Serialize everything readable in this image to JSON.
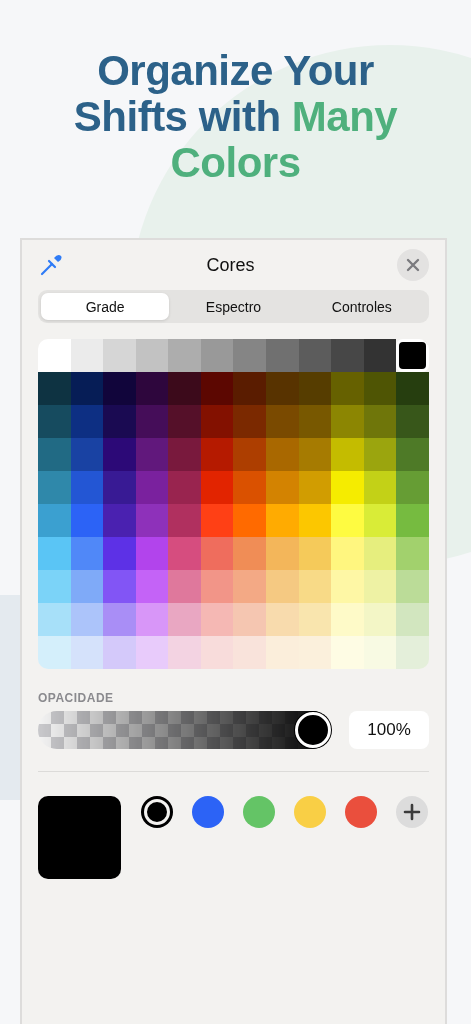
{
  "headline": {
    "parts": [
      {
        "text": "Organize Your Shifts with ",
        "accent": false
      },
      {
        "text": "Many Colors",
        "accent": true
      }
    ]
  },
  "sheet": {
    "title": "Cores"
  },
  "tabs": [
    {
      "label": "Grade",
      "selected": true
    },
    {
      "label": "Espectro",
      "selected": false
    },
    {
      "label": "Controles",
      "selected": false
    }
  ],
  "grid": [
    {
      "swatches": [
        {
          "color": "#ffffff",
          "selected": false
        },
        {
          "color": "#ebebeb",
          "selected": false
        },
        {
          "color": "#d6d6d6",
          "selected": false
        },
        {
          "color": "#c2c2c2",
          "selected": false
        },
        {
          "color": "#adadad",
          "selected": false
        },
        {
          "color": "#999999",
          "selected": false
        },
        {
          "color": "#858585",
          "selected": false
        },
        {
          "color": "#707070",
          "selected": false
        },
        {
          "color": "#5c5c5c",
          "selected": false
        },
        {
          "color": "#474747",
          "selected": false
        },
        {
          "color": "#333333",
          "selected": false
        },
        {
          "color": "#000000",
          "selected": true
        }
      ]
    },
    {
      "swatches": [
        {
          "color": "#0e3342",
          "selected": false
        },
        {
          "color": "#061d56",
          "selected": false
        },
        {
          "color": "#11053b",
          "selected": false
        },
        {
          "color": "#2e063d",
          "selected": false
        },
        {
          "color": "#3c0a1b",
          "selected": false
        },
        {
          "color": "#5c0701",
          "selected": false
        },
        {
          "color": "#5a1c00",
          "selected": false
        },
        {
          "color": "#583300",
          "selected": false
        },
        {
          "color": "#563d00",
          "selected": false
        },
        {
          "color": "#666100",
          "selected": false
        },
        {
          "color": "#4f5504",
          "selected": false
        },
        {
          "color": "#263e0f",
          "selected": false
        }
      ]
    },
    {
      "swatches": [
        {
          "color": "#164b5f",
          "selected": false
        },
        {
          "color": "#0d2f83",
          "selected": false
        },
        {
          "color": "#1a0a52",
          "selected": false
        },
        {
          "color": "#450d59",
          "selected": false
        },
        {
          "color": "#551029",
          "selected": false
        },
        {
          "color": "#831100",
          "selected": false
        },
        {
          "color": "#7b2900",
          "selected": false
        },
        {
          "color": "#7a4a00",
          "selected": false
        },
        {
          "color": "#785800",
          "selected": false
        },
        {
          "color": "#8c8602",
          "selected": false
        },
        {
          "color": "#6f760a",
          "selected": false
        },
        {
          "color": "#38571a",
          "selected": false
        }
      ]
    },
    {
      "swatches": [
        {
          "color": "#216a84",
          "selected": false
        },
        {
          "color": "#1942a3",
          "selected": false
        },
        {
          "color": "#2c0977",
          "selected": false
        },
        {
          "color": "#61187c",
          "selected": false
        },
        {
          "color": "#79193d",
          "selected": false
        },
        {
          "color": "#b51a00",
          "selected": false
        },
        {
          "color": "#ad3e00",
          "selected": false
        },
        {
          "color": "#a96800",
          "selected": false
        },
        {
          "color": "#a67b01",
          "selected": false
        },
        {
          "color": "#c4bc00",
          "selected": false
        },
        {
          "color": "#9ba50e",
          "selected": false
        },
        {
          "color": "#4e7a27",
          "selected": false
        }
      ]
    },
    {
      "swatches": [
        {
          "color": "#2f88aa",
          "selected": false
        },
        {
          "color": "#2356d4",
          "selected": false
        },
        {
          "color": "#381a94",
          "selected": false
        },
        {
          "color": "#7a219e",
          "selected": false
        },
        {
          "color": "#99244f",
          "selected": false
        },
        {
          "color": "#e22400",
          "selected": false
        },
        {
          "color": "#da5100",
          "selected": false
        },
        {
          "color": "#d38301",
          "selected": false
        },
        {
          "color": "#d19d01",
          "selected": false
        },
        {
          "color": "#f5ec00",
          "selected": false
        },
        {
          "color": "#c3d117",
          "selected": false
        },
        {
          "color": "#669d34",
          "selected": false
        }
      ]
    },
    {
      "swatches": [
        {
          "color": "#3ba0d0",
          "selected": false
        },
        {
          "color": "#2c63f6",
          "selected": false
        },
        {
          "color": "#4a21b0",
          "selected": false
        },
        {
          "color": "#8e31ba",
          "selected": false
        },
        {
          "color": "#b0305f",
          "selected": false
        },
        {
          "color": "#ff4015",
          "selected": false
        },
        {
          "color": "#ff6a00",
          "selected": false
        },
        {
          "color": "#ffab01",
          "selected": false
        },
        {
          "color": "#fcc700",
          "selected": false
        },
        {
          "color": "#fefb41",
          "selected": false
        },
        {
          "color": "#d9ec37",
          "selected": false
        },
        {
          "color": "#76bb40",
          "selected": false
        }
      ]
    },
    {
      "swatches": [
        {
          "color": "#5ac5f5",
          "selected": false
        },
        {
          "color": "#5088f8",
          "selected": false
        },
        {
          "color": "#5d31e6",
          "selected": false
        },
        {
          "color": "#b244ec",
          "selected": false
        },
        {
          "color": "#d64d7f",
          "selected": false
        },
        {
          "color": "#ef6d5d",
          "selected": false
        },
        {
          "color": "#f08d56",
          "selected": false
        },
        {
          "color": "#f3b65a",
          "selected": false
        },
        {
          "color": "#f5ca5a",
          "selected": false
        },
        {
          "color": "#fff67f",
          "selected": false
        },
        {
          "color": "#e6ee7e",
          "selected": false
        },
        {
          "color": "#a2d16d",
          "selected": false
        }
      ]
    },
    {
      "swatches": [
        {
          "color": "#7bd3f8",
          "selected": false
        },
        {
          "color": "#7faaf8",
          "selected": false
        },
        {
          "color": "#8255f5",
          "selected": false
        },
        {
          "color": "#c463f7",
          "selected": false
        },
        {
          "color": "#df789c",
          "selected": false
        },
        {
          "color": "#f29588",
          "selected": false
        },
        {
          "color": "#f3a985",
          "selected": false
        },
        {
          "color": "#f5c982",
          "selected": false
        },
        {
          "color": "#f8da87",
          "selected": false
        },
        {
          "color": "#fef7a5",
          "selected": false
        },
        {
          "color": "#eef2a4",
          "selected": false
        },
        {
          "color": "#bbdc98",
          "selected": false
        }
      ]
    },
    {
      "swatches": [
        {
          "color": "#a7e0f9",
          "selected": false
        },
        {
          "color": "#acc4fa",
          "selected": false
        },
        {
          "color": "#a98ef6",
          "selected": false
        },
        {
          "color": "#d896f8",
          "selected": false
        },
        {
          "color": "#e9a7c2",
          "selected": false
        },
        {
          "color": "#f5b8b4",
          "selected": false
        },
        {
          "color": "#f5c6b1",
          "selected": false
        },
        {
          "color": "#f8dbad",
          "selected": false
        },
        {
          "color": "#f9e5ae",
          "selected": false
        },
        {
          "color": "#fefac8",
          "selected": false
        },
        {
          "color": "#f3f6c6",
          "selected": false
        },
        {
          "color": "#d2e6bf",
          "selected": false
        }
      ]
    },
    {
      "swatches": [
        {
          "color": "#d4effb",
          "selected": false
        },
        {
          "color": "#d5e2fb",
          "selected": false
        },
        {
          "color": "#d4c9fa",
          "selected": false
        },
        {
          "color": "#e8cbfb",
          "selected": false
        },
        {
          "color": "#f3d3e2",
          "selected": false
        },
        {
          "color": "#f8dcdb",
          "selected": false
        },
        {
          "color": "#f9e3db",
          "selected": false
        },
        {
          "color": "#fbeedb",
          "selected": false
        },
        {
          "color": "#fbf0dc",
          "selected": false
        },
        {
          "color": "#fefce4",
          "selected": false
        },
        {
          "color": "#f8fae3",
          "selected": false
        },
        {
          "color": "#e4efda",
          "selected": false
        }
      ]
    }
  ],
  "opacity": {
    "label": "OPACIDADE",
    "level": 1.0,
    "reading": "100%"
  },
  "current_color": {
    "color": "#000000"
  },
  "favorites": [
    {
      "color": "#000000",
      "selected": true
    },
    {
      "color": "#2c63f6",
      "selected": false
    },
    {
      "color": "#64c466",
      "selected": false
    },
    {
      "color": "#f9cf45",
      "selected": false
    },
    {
      "color": "#ea4f3d",
      "selected": false
    }
  ]
}
